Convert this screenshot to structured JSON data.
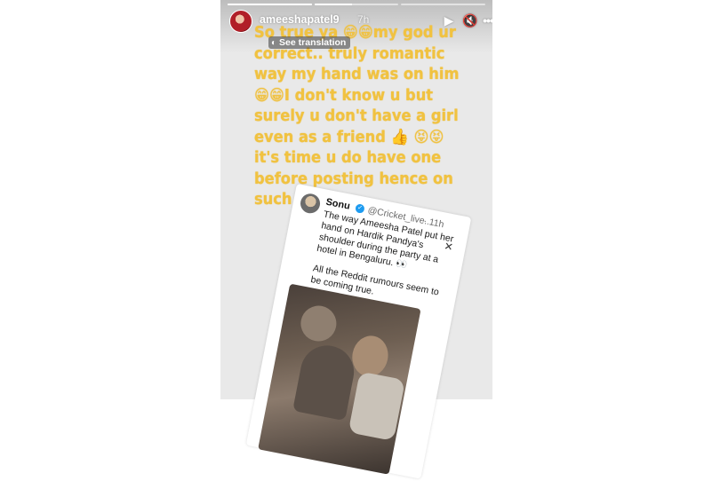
{
  "story": {
    "username": "ameeshapatel9",
    "time_ago": "7h",
    "progress": [
      1.0,
      0.45,
      0.0
    ],
    "translate_label": "See translation",
    "caption": "So true ya 😁😁my god ur correct.. truly romantic way my hand was on him 😁😁I don't know u but surely u don't have a girl even as a friend 👍 😝😝it's time u do have one before posting  hence on such things .."
  },
  "tweet": {
    "name": "Sonu",
    "handle": "@Cricket_live...",
    "time": "· 11h",
    "body1": "The way Ameesha Patel put her hand on Hardik Pandya's shoulder during the party at a hotel in Bengaluru. 👀",
    "body2": "All the Reddit rumours seem to be coming true."
  },
  "colors": {
    "caption": "#f1c240",
    "story_bg": "#e9e9e9",
    "verified": "#1d9bf0"
  }
}
